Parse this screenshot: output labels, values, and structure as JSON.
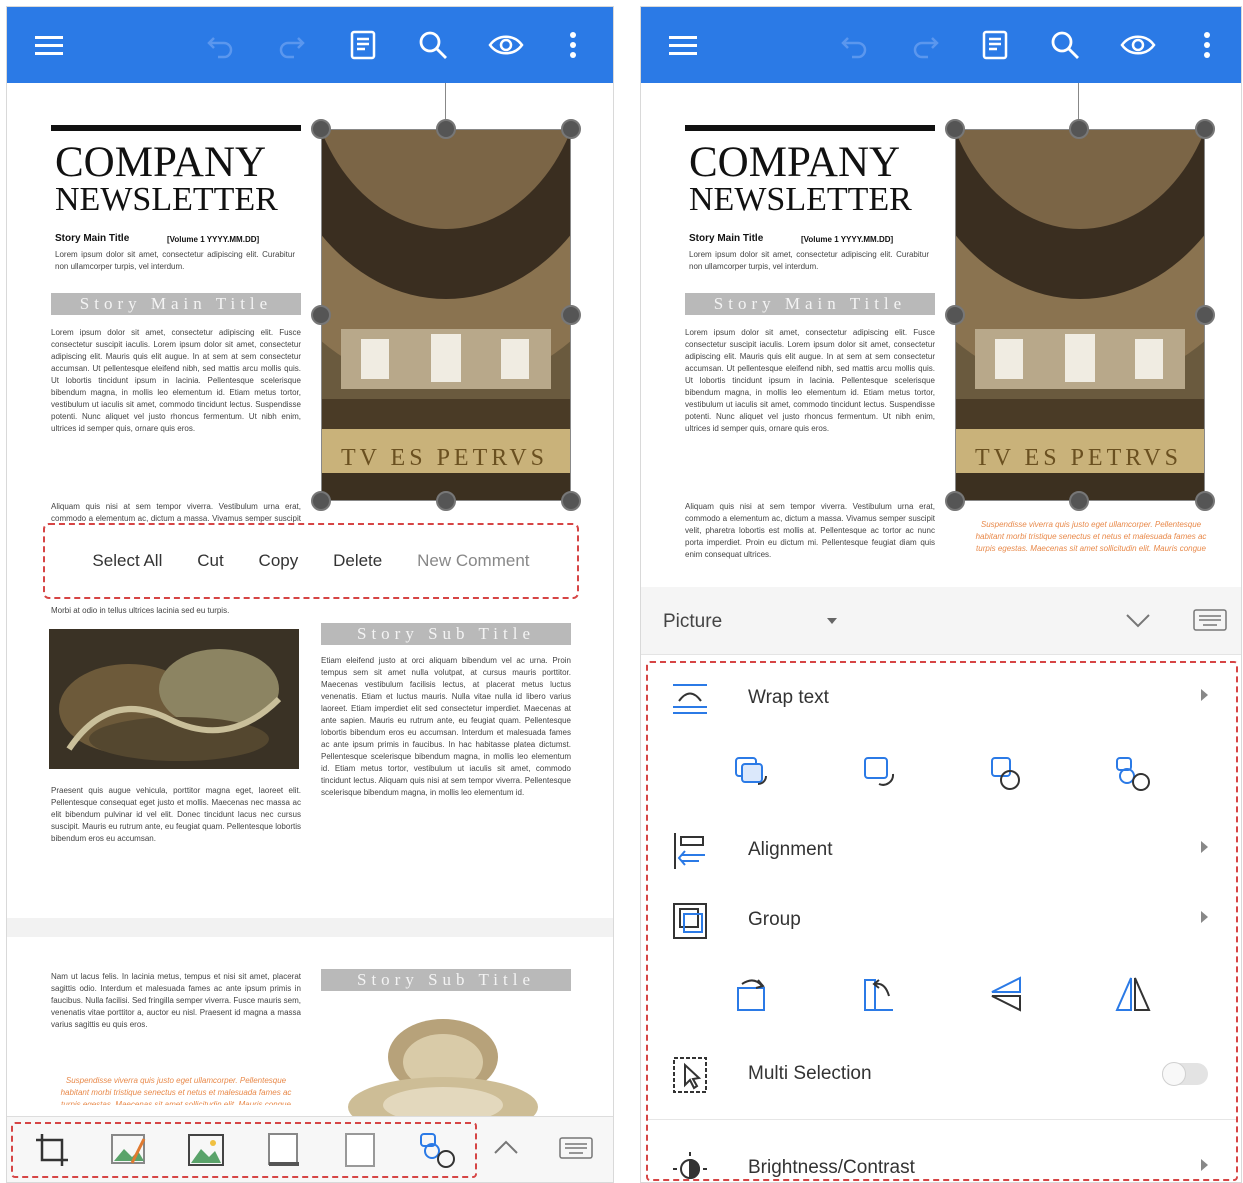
{
  "newsletter": {
    "company": "COMPANY",
    "newsletter": "NEWSLETTER",
    "story_main_title_label": "Story Main Title",
    "volume": "[Volume 1 YYYY.MM.DD]",
    "intro_text": "Lorem ipsum dolor sit amet, consectetur adipiscing elit. Curabitur non ullamcorper turpis, vel interdum.",
    "story_main_title_bar": "Story Main Title",
    "body_text": "Lorem ipsum dolor sit amet, consectetur adipiscing elit. Fusce consectetur suscipit iaculis. Lorem ipsum dolor sit amet, consectetur adipiscing elit. Mauris quis elit augue. In at sem at sem consectetur accumsan. Ut pellentesque eleifend nibh, sed mattis arcu mollis quis. Ut lobortis tincidunt ipsum in lacinia. Pellentesque scelerisque bibendum magna, in mollis leo elementum id. Etiam metus tortor, vestibulum ut iaculis sit amet, commodo tincidunt lectus. Suspendisse potenti. Nunc aliquet vel justo rhoncus fermentum. Ut nibh enim, ultrices id semper quis, ornare quis eros.",
    "body_text_2": "Aliquam quis nisi at sem tempor viverra. Vestibulum urna erat, commodo a elementum ac, dictum a massa. Vivamus semper suscipit velit, pharetra lobortis est mollis at. Pellentesque ac tortor ac nunc porta imperdiet. Proin eu dictum mi. Pellentesque feugiat diam quis enim consequat ultrices.",
    "body_text_3": "Morbi at odio in tellus ultrices lacinia sed eu turpis.",
    "story_sub_title_1": "Story Sub Title",
    "sub_text": "Etiam eleifend justo at orci aliquam bibendum vel ac urna. Proin tempus sem sit amet nulla volutpat, at cursus mauris porttitor. Maecenas vestibulum facilisis lectus, at placerat metus luctus venenatis. Etiam et luctus mauris. Nulla vitae nulla id libero varius laoreet. Etiam imperdiet elit sed consectetur imperdiet. Maecenas at ante sapien. Mauris eu rutrum ante, eu feugiat quam. Pellentesque lobortis bibendum eros eu accumsan. Interdum et malesuada fames ac ante ipsum primis in faucibus. In hac habitasse platea dictumst. Pellentesque scelerisque bibendum magna, in mollis leo elementum id. Etiam metus tortor, vestibulum ut iaculis sit amet, commodo tincidunt lectus. Aliquam quis nisi at sem tempor viverra. Pellentesque scelerisque bibendum magna, in mollis leo elementum id.",
    "left_text_2": "Praesent quis augue vehicula, porttitor magna eget, laoreet elit. Pellentesque consequat eget justo et mollis. Maecenas nec massa ac elit bibendum pulvinar id vel elit. Donec tincidunt lacus nec cursus suscipit. Mauris eu rutrum ante, eu feugiat quam. Pellentesque lobortis bibendum eros eu accumsan.",
    "page2_text": "Nam ut lacus felis. In lacinia metus, tempus et nisi sit amet, placerat sagittis odio. Interdum et malesuada fames ac ante ipsum primis in faucibus. Nulla facilisi. Sed fringilla semper viverra. Fusce mauris sem, venenatis vitae porttitor a, auctor eu nisl. Praesent id magna a massa varius sagittis eu quis eros.",
    "story_sub_title_2": "Story Sub Title",
    "orange_quote": "Suspendisse viverra quis justo eget ullamcorper. Pellentesque habitant morbi tristique senectus et netus et malesuada fames ac turpis egestas. Maecenas sit amet sollicitudin elit. Mauris congue"
  },
  "context_menu": {
    "select_all": "Select All",
    "cut": "Cut",
    "copy": "Copy",
    "delete": "Delete",
    "new_comment": "New Comment"
  },
  "sheet": {
    "object_type": "Picture",
    "rows": {
      "wrap_text": "Wrap text",
      "alignment": "Alignment",
      "group": "Group",
      "multi_selection": "Multi Selection",
      "brightness_contrast": "Brightness/Contrast"
    },
    "multi_selection_on": false
  },
  "colors": {
    "appbar": "#2b7ae6",
    "accent_dash": "#d64545",
    "icon_blue": "#2b7ae6"
  },
  "icons": {
    "appbar": [
      "menu-icon",
      "undo-icon",
      "redo-icon",
      "document-icon",
      "search-icon",
      "eye-icon",
      "more-vert-icon"
    ],
    "bottom_tools": [
      "crop-icon",
      "edit-picture-icon",
      "picture-icon",
      "shadow-icon",
      "border-icon",
      "arrange-icon",
      "chevron-up-icon",
      "keyboard-icon"
    ]
  }
}
